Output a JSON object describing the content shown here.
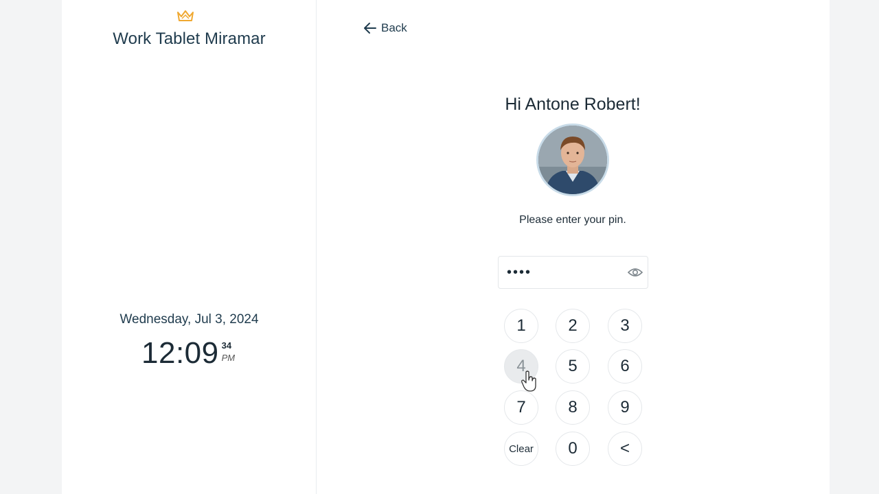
{
  "sidebar": {
    "logo_icon": "crown-icon",
    "location_title": "Work Tablet Miramar",
    "date": "Wednesday, Jul 3, 2024",
    "clock": {
      "time": "12:09",
      "seconds": "34",
      "ampm": "PM"
    }
  },
  "main": {
    "back_label": "Back",
    "back_icon": "arrow-left-icon",
    "greeting": "Hi Antone Robert!",
    "instruction": "Please enter your pin.",
    "pin_value": "••••",
    "show_pin_icon": "eye-icon",
    "keypad": [
      {
        "label": "1"
      },
      {
        "label": "2"
      },
      {
        "label": "3"
      },
      {
        "label": "4"
      },
      {
        "label": "5"
      },
      {
        "label": "6"
      },
      {
        "label": "7"
      },
      {
        "label": "8"
      },
      {
        "label": "9"
      },
      {
        "label": "Clear"
      },
      {
        "label": "0"
      },
      {
        "label": "<"
      }
    ]
  },
  "colors": {
    "accent_logo": "#f0a830",
    "text": "#1f3b4d",
    "page_bg": "#f3f4f5",
    "key_pressed_bg": "#e9ebed"
  }
}
